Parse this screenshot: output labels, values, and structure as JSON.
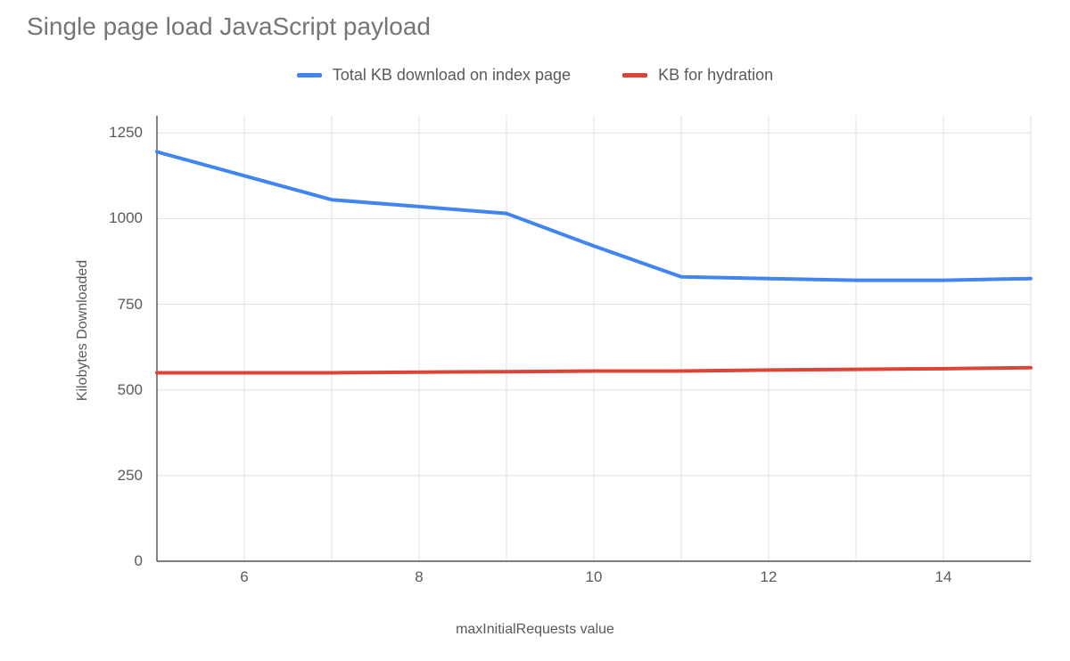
{
  "chart_data": {
    "type": "line",
    "title": "Single page load JavaScript payload",
    "xlabel": "maxInitialRequests value",
    "ylabel": "Kilobytes Downloaded",
    "x": [
      5,
      6,
      7,
      8,
      9,
      10,
      11,
      12,
      13,
      14,
      15
    ],
    "x_ticks": [
      6,
      8,
      10,
      12,
      14
    ],
    "y_ticks": [
      0,
      250,
      500,
      750,
      1000,
      1250
    ],
    "xlim": [
      5,
      15
    ],
    "ylim": [
      0,
      1300
    ],
    "series": [
      {
        "name": "Total KB download on index page",
        "color": "#4185f3",
        "values": [
          1195,
          1125,
          1055,
          1035,
          1015,
          920,
          830,
          825,
          820,
          820,
          825
        ]
      },
      {
        "name": "KB for hydration",
        "color": "#db4437",
        "values": [
          550,
          550,
          550,
          552,
          553,
          555,
          555,
          558,
          560,
          562,
          565
        ]
      }
    ]
  }
}
